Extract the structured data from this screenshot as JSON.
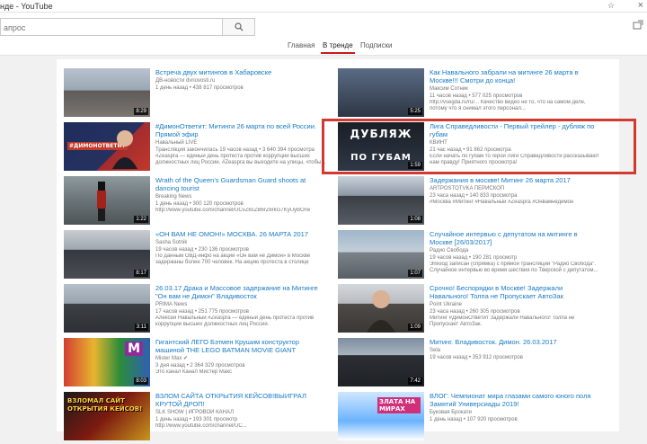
{
  "window": {
    "title": "нде - YouTube",
    "close_glyph": "×",
    "pin_glyph": "☆"
  },
  "search": {
    "placeholder": "апрос"
  },
  "tabs": [
    {
      "label": "Главная"
    },
    {
      "label": "В тренде"
    },
    {
      "label": "Подписки"
    }
  ],
  "left_videos": [
    {
      "title": "Встреча двух митингов в Хабаровске",
      "channel": "ДВ-новости dvnovosti.ru",
      "meta": "1 день назад • 438 817 просмотров",
      "desc": "",
      "duration": "8:29"
    },
    {
      "title": "#ДимонОтветит: Митинги 26 марта по всей России. Прямой эфир",
      "channel": "Навальный LIVE",
      "meta": "Трансляция закончилась 19 часов назад • 3 640 394 просмотра",
      "desc": "#Zeaspra — единый день протеста против коррупции высших должностных лиц России. #Zeaspra вы выходите на улицы, чтобы...",
      "duration": "",
      "overlay_text": "#ДИМОНОТВЕТИТ"
    },
    {
      "title": "Wrath of the Queen's Guardsman Guard shoots at dancing tourist",
      "channel": "Breaking News",
      "meta": "1 день назад • 300 120 просмотров",
      "desc": "http://www.youtube.com/channel/UCvZ6cZB6rZ6rkG7KyUyBOrw",
      "duration": "1:22"
    },
    {
      "title": "«ОН ВАМ НЕ ОМОН!» МОСКВА. 26 МАРТА 2017",
      "channel": "Sasha Sotnik",
      "meta": "19 часов назад • 230 136 просмотров",
      "desc": "По данным ОВД-инфо на акции «Он вам не Димон» в Москве задержаны более 700 человек. На акцию протеста в столице России...",
      "duration": "8:17"
    },
    {
      "title": "26.03.17 Драка и Массовое задержание на Митинге \"Он вам не Димон\" Владивосток",
      "channel": "PRIMA News",
      "meta": "17 часов назад • 251 775 просмотров",
      "desc": "Алексей Навальный #Zeaspra — единый день протеста против коррупции высших должностных лиц России.",
      "duration": "3:11"
    },
    {
      "title": "Гигантский ЛЕГО Бэтмен Крушим конструктор машиной THE LEGO BATMAN MOVIE GIANT BUILDING",
      "channel": "Mister Max ✔",
      "meta": "3 дня назад • 2 364 329 просмотров",
      "desc": "Это канал Канал Мистер Макс",
      "duration": "8:03",
      "overlay_text": "M"
    },
    {
      "title": "ВЗЛОМ САЙТА ОТКРЫТИЯ КЕЙСОВ!ВЫИГРАЛ КРУТОЙ ДРОП!",
      "channel": "SLK SHOW | ИГРОВОЙ КАНАЛ",
      "meta": "1 день назад • 193 301 просмотр",
      "desc": "http://www.youtube.com/channel/UC...",
      "duration": "",
      "overlay_text": "ВЗЛОМАЛ САЙТ ОТКРЫТИЯ КЕЙСОВ!"
    }
  ],
  "right_videos": [
    {
      "title": "Как Навального забрали на митинге 26 марта в Москве!!! Смотри до конца!",
      "channel": "Максим Сотник",
      "meta": "11 часов назад • 577 025 просмотров",
      "desc": "http://vsegda.ru/ru/... Качество видео не то, что на самом деле, потому что я снимал этого персонал...",
      "duration": "5:25"
    },
    {
      "title": "Лига Справедливости - Первый трейлер - дубляж по губам",
      "channel": "КВИНТ",
      "meta": "21 час назад • 91 862 просмотра",
      "desc": "Если начать по губам то герои Лиги Справедливости рассказывают нам правду! Приятного просмотра!",
      "duration": "1:59",
      "overlay_top": "ДУБЛЯЖ",
      "overlay_bottom": "ПО ГУБАМ"
    },
    {
      "title": "Задержания в москве! Митинг 26 марта 2017",
      "channel": "ARTPOSTOTVKA ПЕРИСКОП",
      "meta": "23 часа назад • 140 833 просмотра",
      "desc": "#Москва #Митинг #Навальный #Zeaspra #Онвамнедимон",
      "duration": "1:08"
    },
    {
      "title": "Случайное интервью с депутатом на митинге в Москве [26/03/2017]",
      "channel": "Радио Свобода",
      "meta": "19 часов назад • 190 281 просмотр",
      "desc": "Эпизод записан (спрямка) с прямой трансляции \"Радио Свобода\". Случайное интервью во время шествия по Тверской с депутатом...",
      "duration": "1:07"
    },
    {
      "title": "Срочно! Беспорядки в Москве! Задержали Навального! Толпа не Пропускает АвтоЗак",
      "channel": "Point Ukraine",
      "meta": "23 часа назад • 260 305 просмотров",
      "desc": "Митинг #ДимонОтветит Задержали Навального! Толпа не Пропускает АвтоЗак.",
      "duration": "1:09"
    },
    {
      "title": "Митинг. Владивосток. Димон. 26.03.2017",
      "channel": "Sela",
      "meta": "19 часов назад • 353 912 просмотров",
      "desc": "",
      "duration": "7:42"
    },
    {
      "title": "ВЛОГ: Чемпионат мира глазами самого юного поля Замятий Универсиады 2019!",
      "channel": "Буковая Брокати",
      "meta": "1 день назад • 107 920 просмотров",
      "desc": "",
      "duration": "",
      "overlay_text": "ЗЛАТА НА МИРАХ"
    }
  ],
  "colors": {
    "accent_red": "#cc181e",
    "link_blue": "#167ac6",
    "highlight_red": "#d03a32"
  }
}
